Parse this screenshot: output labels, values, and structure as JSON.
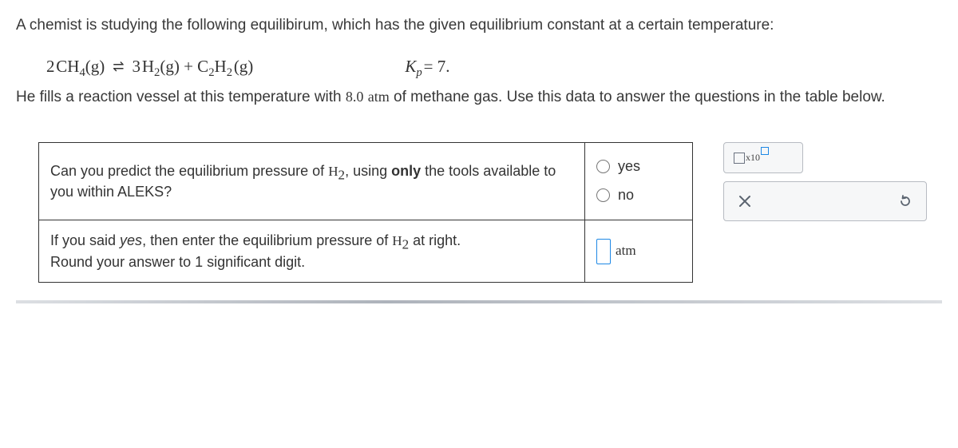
{
  "intro": "A chemist is studying the following equilibirum, which has the given equilibrium constant at a certain temperature:",
  "equation": {
    "lhs_coef": "2",
    "lhs_species": "CH",
    "lhs_sub": "4",
    "lhs_state": "(g)",
    "rhs1_coef": "3",
    "rhs1_species": "H",
    "rhs1_sub": "2",
    "rhs1_state": "(g)",
    "plus": " + ",
    "rhs2_species": "C",
    "rhs2_sub": "2",
    "rhs2_species2": "H",
    "rhs2_sub2": "2",
    "rhs2_state": "(g)",
    "kp_label": "K",
    "kp_sub": "p",
    "kp_eq": " = 7."
  },
  "fill": {
    "pre": "He fills a reaction vessel at this temperature with ",
    "value": "8.0",
    "unit": "atm",
    "post": " of methane gas. Use this data to answer the questions in the table below."
  },
  "q1": {
    "pre": "Can you predict the equilibrium pressure of ",
    "species": "H",
    "sub": "2",
    "mid": ", using ",
    "only": "only",
    "post": " the tools available to you within ALEKS?"
  },
  "answers": {
    "yes": "yes",
    "no": "no"
  },
  "q2": {
    "pre": "If you said ",
    "yes": "yes",
    "mid": ", then enter the equilibrium pressure of ",
    "species": "H",
    "sub": "2",
    "post": " at right.",
    "round": "Round your answer to 1 significant digit."
  },
  "entry": {
    "unit": "atm",
    "placeholder": ""
  },
  "tools": {
    "x10": "x10"
  }
}
